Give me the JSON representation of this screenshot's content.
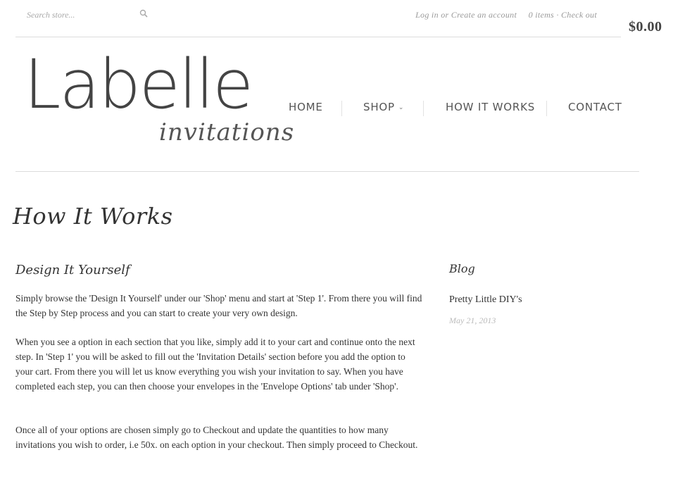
{
  "search": {
    "placeholder": "Search store..."
  },
  "account": {
    "login": "Log in",
    "or": "or",
    "create": "Create an account"
  },
  "cart": {
    "items": "0 items",
    "sep": "·",
    "checkout": "Check out",
    "total": "$0.00"
  },
  "logo": {
    "main": "Labelle",
    "sub": "invitations"
  },
  "nav": {
    "items": [
      "HOME",
      "SHOP",
      "HOW IT WORKS",
      "CONTACT"
    ]
  },
  "page": {
    "title": "How It Works",
    "section_title": "Design It Yourself",
    "paragraphs": [
      "Simply browse the 'Design It Yourself' under our 'Shop' menu and start at 'Step 1'. From there you will find the Step by Step process and you can start to create your very own design.",
      "When you see a option in each section that you like, simply add it to your cart and continue onto the next step. In 'Step 1' you will be asked to fill out the 'Invitation Details' section before you add the option to your cart. From there you will let us know everything you wish your invitation to say. When you have completed each step, you can then choose your envelopes in the 'Envelope Options' tab under 'Shop'.",
      "Once all of your options are chosen simply go to Checkout and update the quantities to how many invitations you wish to order, i.e 50x. on each option in your checkout. Then simply proceed to Checkout."
    ]
  },
  "sidebar": {
    "title": "Blog",
    "post_title": "Pretty Little DIY's",
    "post_date": "May 21, 2013"
  }
}
